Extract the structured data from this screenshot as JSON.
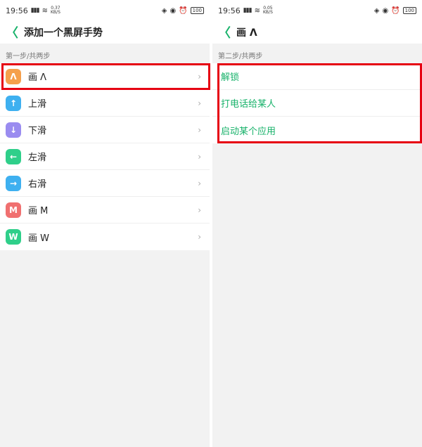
{
  "colors": {
    "accent": "#17b26a",
    "highlight": "#e60012"
  },
  "left": {
    "status": {
      "time": "19:56",
      "signal": "▮▮▮",
      "wifi": "≋",
      "speed_top": "0.37",
      "speed_bottom": "KB/S",
      "battery": "100"
    },
    "header": {
      "title": "添加一个黑屏手势"
    },
    "section": "第一步/共两步",
    "items": [
      {
        "label": "画 Λ",
        "glyph": "Λ",
        "color": "#f5a04c"
      },
      {
        "label": "上滑",
        "glyph": "↑",
        "color": "#3eb0f0"
      },
      {
        "label": "下滑",
        "glyph": "↓",
        "color": "#9a8cf0"
      },
      {
        "label": "左滑",
        "glyph": "←",
        "color": "#2fcf8a"
      },
      {
        "label": "右滑",
        "glyph": "→",
        "color": "#3eb0f0"
      },
      {
        "label": "画 M",
        "glyph": "M",
        "color": "#f07070"
      },
      {
        "label": "画 W",
        "glyph": "W",
        "color": "#2fcf8a"
      }
    ],
    "chevron": "›"
  },
  "right": {
    "status": {
      "time": "19:56",
      "signal": "▮▮▮",
      "wifi": "≋",
      "speed_top": "0.05",
      "speed_bottom": "KB/S",
      "battery": "100"
    },
    "header": {
      "title": "画 Λ"
    },
    "section": "第二步/共两步",
    "actions": [
      "解锁",
      "打电话给某人",
      "启动某个应用"
    ]
  },
  "icons": {
    "back": "chevron-left-icon",
    "status_extra": [
      "vibrate-icon",
      "alarm-clock-icon",
      "dnd-icon"
    ]
  },
  "back_glyph": "〈"
}
